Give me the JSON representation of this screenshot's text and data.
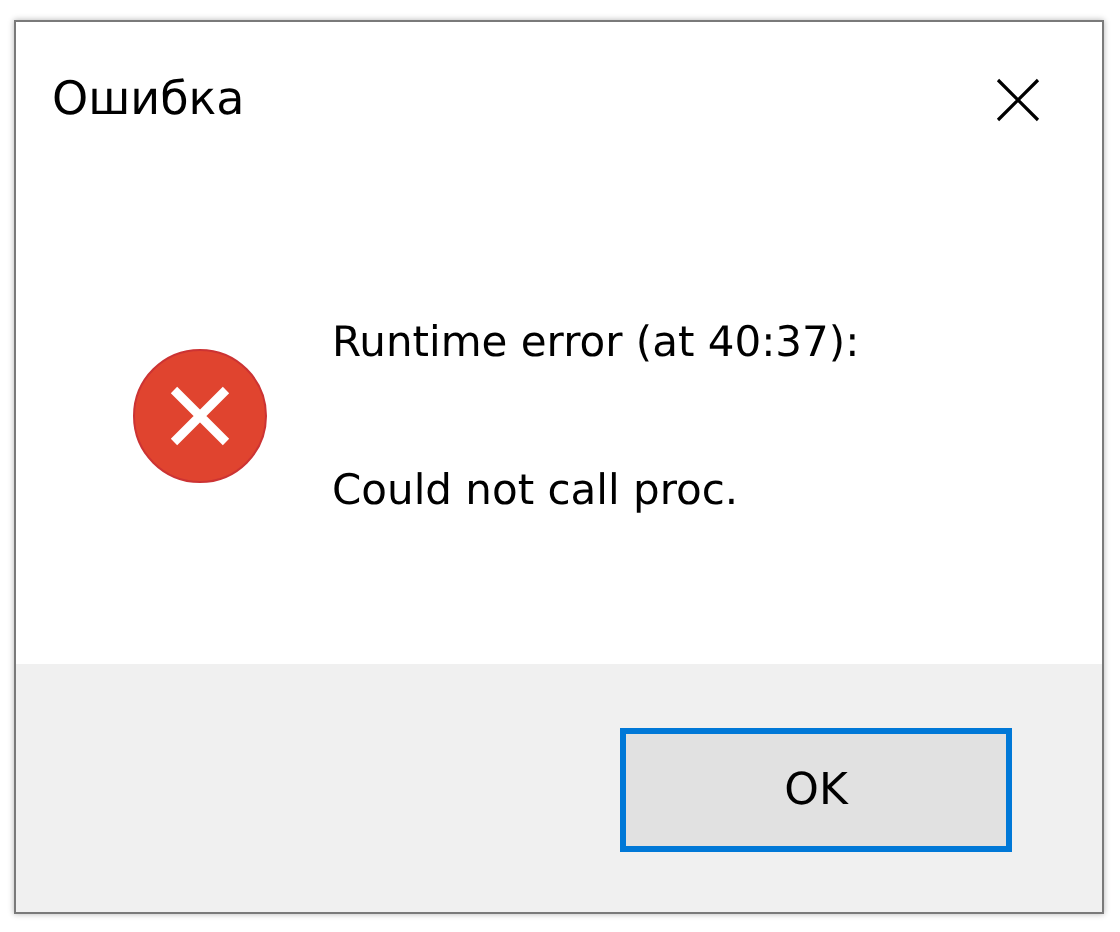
{
  "window": {
    "title": "Ошибка"
  },
  "message": {
    "kind": "error",
    "lines": [
      "Runtime error (at 40:37):",
      "Could not call proc."
    ]
  },
  "buttons": [
    {
      "label": "OK",
      "selected": true
    }
  ]
}
